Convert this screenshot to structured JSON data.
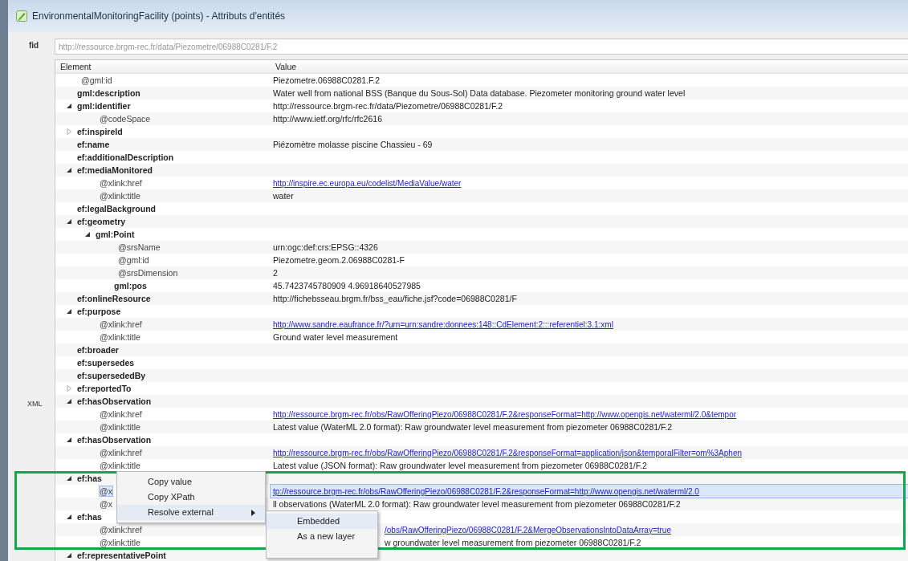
{
  "window": {
    "title": "EnvironmentalMonitoringFacility (points) - Attributs d'entités"
  },
  "fid": {
    "label": "fid",
    "value": "http://ressource.brgm-rec.fr/data/Piezometre/06988C0281/F.2",
    "disabled": true
  },
  "xml_label": "XML",
  "tree": {
    "columns": [
      "Element",
      "Value"
    ],
    "nodes": [
      {
        "name": "@gml:id",
        "kind": "attribute",
        "value": "Piezometre.06988C0281.F.2",
        "link": false,
        "selected": false
      },
      {
        "name": "gml:description",
        "kind": "element",
        "value": "Water well from national BSS (Banque du Sous-Sol) Data database. Piezometer monitoring ground water level",
        "link": false,
        "selected": false
      },
      {
        "name": "gml:identifier",
        "kind": "element",
        "value": "http://ressource.brgm-rec.fr/data/Piezometre/06988C0281/F.2",
        "link": false,
        "expanded": true,
        "selected": false,
        "children": [
          {
            "name": "@codeSpace",
            "kind": "attribute",
            "value": "http://www.ietf.org/rfc/rfc2616",
            "link": false,
            "selected": false
          }
        ]
      },
      {
        "name": "ef:inspireId",
        "kind": "element",
        "expanded": false,
        "selected": false
      },
      {
        "name": "ef:name",
        "kind": "element",
        "value": "Piézomètre molasse piscine Chassieu - 69",
        "link": false,
        "selected": false
      },
      {
        "name": "ef:additionalDescription",
        "kind": "element",
        "selected": false
      },
      {
        "name": "ef:mediaMonitored",
        "kind": "element",
        "expanded": true,
        "selected": false,
        "children": [
          {
            "name": "@xlink:href",
            "kind": "attribute",
            "value": "http://inspire.ec.europa.eu/codelist/MediaValue/water",
            "link": true,
            "selected": false
          },
          {
            "name": "@xlink:title",
            "kind": "attribute",
            "value": "water",
            "link": false,
            "selected": false
          }
        ]
      },
      {
        "name": "ef:legalBackground",
        "kind": "element",
        "selected": false
      },
      {
        "name": "ef:geometry",
        "kind": "element",
        "expanded": true,
        "selected": false,
        "children": [
          {
            "name": "gml:Point",
            "kind": "element",
            "expanded": true,
            "selected": false,
            "children": [
              {
                "name": "@srsName",
                "kind": "attribute",
                "value": "urn:ogc:def:crs:EPSG::4326",
                "link": false,
                "selected": false
              },
              {
                "name": "@gml:id",
                "kind": "attribute",
                "value": "Piezometre.geom.2.06988C0281-F",
                "link": false,
                "selected": false
              },
              {
                "name": "@srsDimension",
                "kind": "attribute",
                "value": "2",
                "link": false,
                "selected": false
              },
              {
                "name": "gml:pos",
                "kind": "element",
                "value": "45.7423745780909 4.96918640527985",
                "link": false,
                "selected": false
              }
            ]
          }
        ]
      },
      {
        "name": "ef:onlineResource",
        "kind": "element",
        "value": "http://fichebsseau.brgm.fr/bss_eau/fiche.jsf?code=06988C0281/F",
        "link": false,
        "selected": false
      },
      {
        "name": "ef:purpose",
        "kind": "element",
        "expanded": true,
        "selected": false,
        "children": [
          {
            "name": "@xlink:href",
            "kind": "attribute",
            "value": "http://www.sandre.eaufrance.fr/?urn=urn:sandre:donnees:148::CdElement:2:::referentiel:3.1:xml",
            "link": true,
            "selected": false
          },
          {
            "name": "@xlink:title",
            "kind": "attribute",
            "value": "Ground water level measurement",
            "link": false,
            "selected": false
          }
        ]
      },
      {
        "name": "ef:broader",
        "kind": "element",
        "selected": false
      },
      {
        "name": "ef:supersedes",
        "kind": "element",
        "selected": false
      },
      {
        "name": "ef:supersededBy",
        "kind": "element",
        "selected": false
      },
      {
        "name": "ef:reportedTo",
        "kind": "element",
        "expanded": false,
        "selected": false
      },
      {
        "name": "ef:hasObservation",
        "kind": "element",
        "expanded": true,
        "selected": false,
        "children": [
          {
            "name": "@xlink:href",
            "kind": "attribute",
            "value": "http://ressource.brgm-rec.fr/obs/RawOfferingPiezo/06988C0281/F.2&responseFormat=http://www.opengis.net/waterml/2.0&tempor",
            "link": true,
            "selected": false
          },
          {
            "name": "@xlink:title",
            "kind": "attribute",
            "value": "Latest value (WaterML 2.0 format): Raw groundwater level measurement from piezometer 06988C0281/F.2",
            "link": false,
            "selected": false
          }
        ]
      },
      {
        "name": "ef:hasObservation",
        "kind": "element",
        "expanded": true,
        "selected": false,
        "children": [
          {
            "name": "@xlink:href",
            "kind": "attribute",
            "value": "http://ressource.brgm-rec.fr/obs/RawOfferingPiezo/06988C0281/F.2&responseFormat=application/json&temporalFilter=om%3Aphen",
            "link": true,
            "selected": false
          },
          {
            "name": "@xlink:title",
            "kind": "attribute",
            "value": "Latest value (JSON format): Raw groundwater level measurement from piezometer 06988C0281/F.2",
            "link": false,
            "selected": false
          }
        ]
      },
      {
        "name": "ef:has",
        "kind": "element",
        "expanded": true,
        "selected": false,
        "children": [
          {
            "name": "@x",
            "kind": "attribute",
            "value": "tp://ressource.brgm-rec.fr/obs/RawOfferingPiezo/06988C0281/F.2&responseFormat=http://www.opengis.net/waterml/2.0",
            "link": true,
            "selected": true
          },
          {
            "name": "@x",
            "kind": "attribute",
            "value": "ll observations (WaterML 2.0 format): Raw groundwater level measurement from piezometer 06988C0281/F.2",
            "link": false,
            "selected": false
          }
        ]
      },
      {
        "name": "ef:has",
        "kind": "element",
        "expanded": true,
        "selected": false,
        "children": [
          {
            "name": "@xlink:href",
            "kind": "attribute",
            "value": "/obs/RawOfferingPiezo/06988C0281/F.2&MergeObservationsIntoDataArray=true",
            "link": true,
            "obscured": true,
            "selected": false
          },
          {
            "name": "@xlink:title",
            "kind": "attribute",
            "value": "w groundwater level measurement from piezometer 06988C0281/F.2",
            "link": false,
            "obscured": true,
            "selected": false
          }
        ]
      },
      {
        "name": "ef:representativePoint",
        "kind": "element",
        "expanded": true,
        "selected": false
      }
    ]
  },
  "context_menu": {
    "items": [
      {
        "label": "Copy value",
        "selected": false
      },
      {
        "label": "Copy XPath",
        "selected": false
      },
      {
        "label": "Resolve external",
        "selected": true,
        "submenu": true
      }
    ],
    "submenu": [
      {
        "label": "Embedded",
        "selected": true
      },
      {
        "label": "As a new layer",
        "selected": false
      }
    ]
  }
}
